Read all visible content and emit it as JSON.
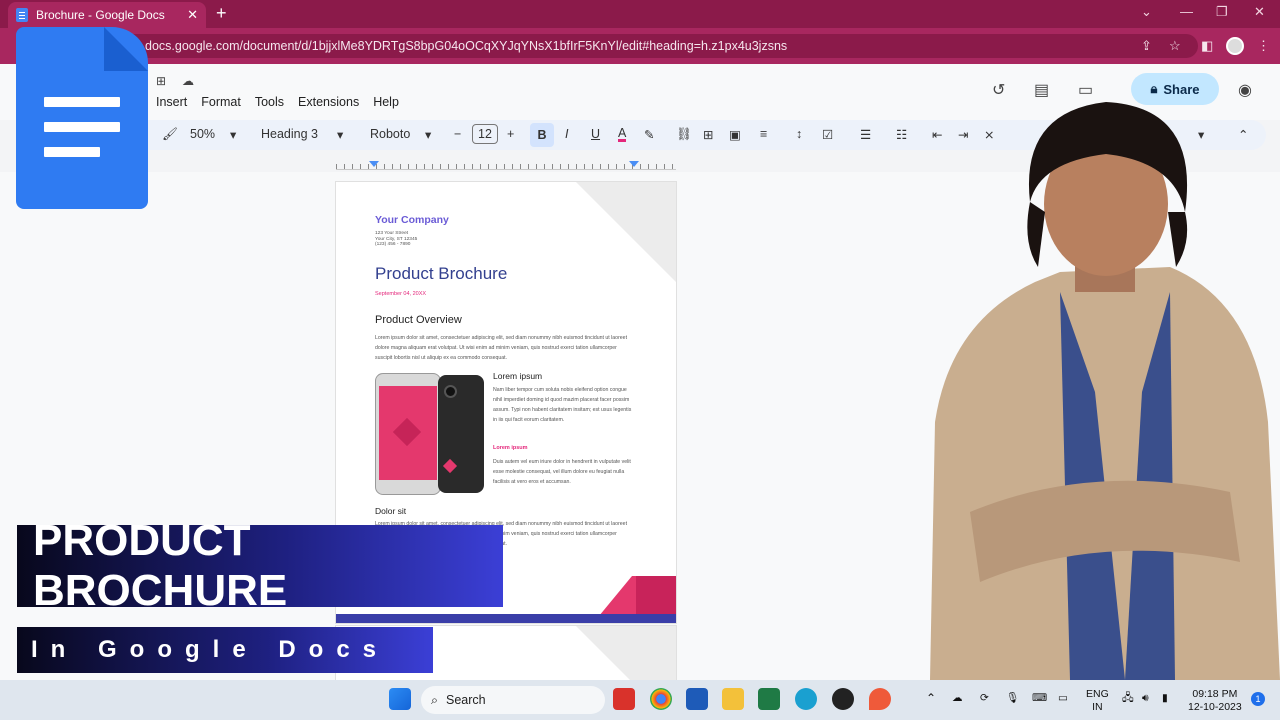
{
  "browser": {
    "tab_title": "Brochure - Google Docs",
    "tab_close": "✕",
    "new_tab": "+",
    "url": "docs.google.com/document/d/1bjjxlMe8YDRTgS8bpG04oOCqXYJqYNsX1bfIrF5KnYl/edit#heading=h.z1px4u3jzsns"
  },
  "docs": {
    "menu": [
      "Insert",
      "Format",
      "Tools",
      "Extensions",
      "Help"
    ],
    "share_label": "Share",
    "toolbar": {
      "zoom": "50%",
      "style": "Heading 3",
      "font": "Roboto",
      "font_size": "12",
      "bold": "B",
      "italic": "I",
      "underline": "U",
      "text_color": "A"
    }
  },
  "document": {
    "company": "Your Company",
    "address": [
      "123 Your Street",
      "Your City, ST 12345",
      "(123) 456 - 7890"
    ],
    "title": "Product Brochure",
    "date": "September 04, 20XX",
    "section1_heading": "Product Overview",
    "section1_body": "Lorem ipsum dolor sit amet, consectetuer adipiscing elit, sed diam nonummy nibh euismod tincidunt ut laoreet dolore magna aliquam erat volutpat. Ut wisi enim ad minim veniam, quis nostrud exerci tation ullamcorper suscipit lobortis nisl ut aliquip ex ea commodo consequat.",
    "sub_heading": "Lorem ipsum",
    "sub_body": "Nam liber tempor cum soluta nobis eleifend option congue nihil imperdiet doming id quod mazim placerat facer possim assum. Typi non habent claritatem insitam; est usus legentis in iis qui facit eorum claritatem.",
    "pink_heading": "Lorem ipsum",
    "pink_body": "Duis autem vel eum iriure dolor in hendrerit in vulputate velit esse molestie consequat, vel illum dolore eu feugiat nulla facilisis at vero eros et accumsan.",
    "section2_heading": "Dolor sit",
    "section2_body": "Lorem ipsum dolor sit amet, consectetuer adipiscing elit, sed diam nonummy nibh euismod tincidunt ut laoreet dolore magna aliquam erat volutpat. Ut wisi enim ad minim veniam, quis nostrud exerci tation ullamcorper suscipit lobortis nisl ut aliquip ex ea commodo consequat."
  },
  "overlay": {
    "banner_title": "PRODUCT BROCHURE",
    "banner_subtitle": "In Google Docs"
  },
  "taskbar": {
    "search_label": "Search",
    "lang_top": "ENG",
    "lang_bottom": "IN",
    "time": "09:18 PM",
    "date": "12-10-2023",
    "notification_count": "1"
  },
  "colors": {
    "chrome_dark": "#8b1a4a",
    "chrome_light": "#a8275f",
    "docs_blue": "#2f7bf2",
    "brochure_pink": "#e4386d",
    "brochure_navy": "#3a3ea8"
  }
}
